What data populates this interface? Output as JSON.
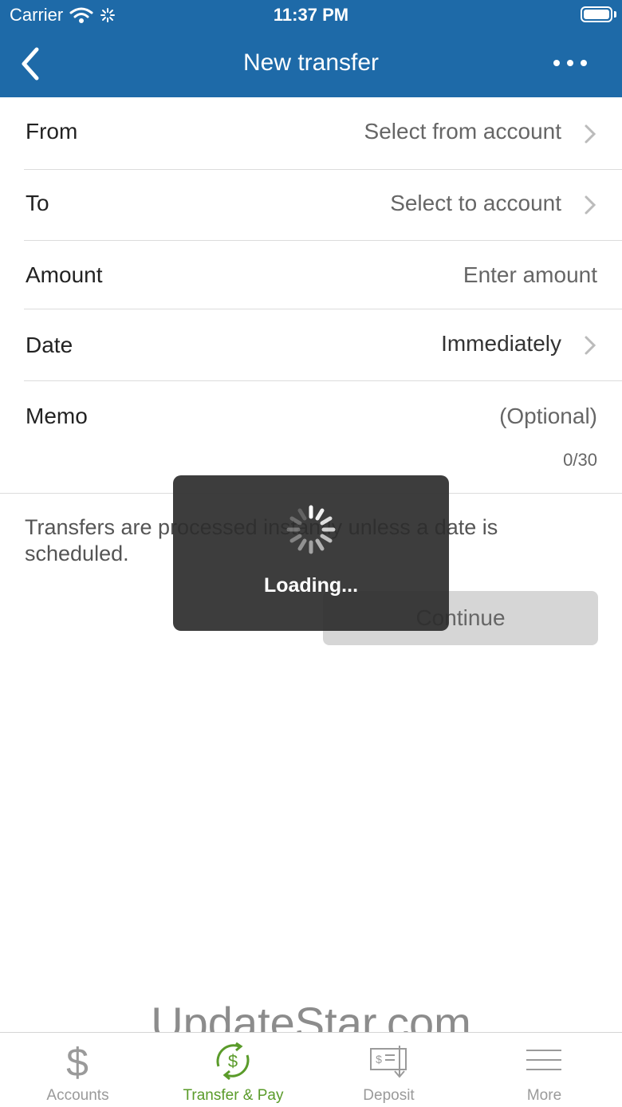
{
  "status_bar": {
    "carrier": "Carrier",
    "time": "11:37 PM"
  },
  "header": {
    "title": "New transfer"
  },
  "form": {
    "from": {
      "label": "From",
      "value": "Select from account"
    },
    "to": {
      "label": "To",
      "value": "Select to account"
    },
    "amount": {
      "label": "Amount",
      "placeholder": "Enter amount"
    },
    "date": {
      "label": "Date",
      "value": "Immediately"
    },
    "memo": {
      "label": "Memo",
      "placeholder": "(Optional)",
      "counter": "0/30"
    }
  },
  "note": "Transfers are processed instantly unless a date is scheduled.",
  "continue_label": "Continue",
  "loading": {
    "text": "Loading..."
  },
  "watermark": "UpdateStar.com",
  "tabs": [
    {
      "label": "Accounts",
      "icon": "dollar-icon"
    },
    {
      "label": "Transfer & Pay",
      "icon": "transfer-pay-icon"
    },
    {
      "label": "Deposit",
      "icon": "check-deposit-icon"
    },
    {
      "label": "More",
      "icon": "menu-icon"
    }
  ],
  "colors": {
    "header": "#1e6aa8",
    "active_tab": "#5a9b2a",
    "inactive_tab": "#9a9a9a"
  }
}
